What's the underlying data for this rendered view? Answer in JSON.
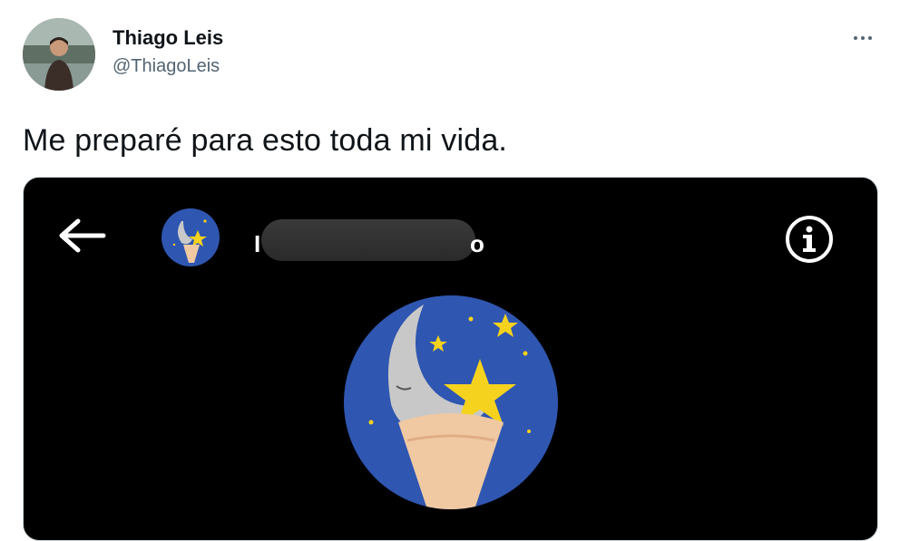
{
  "tweet": {
    "author_name": "Thiago Leis",
    "author_handle": "@ThiagoLeis",
    "text": "Me preparé para esto toda mi vida."
  },
  "screenshot": {
    "chat_name_prefix": "I",
    "chat_name_suffix": "o",
    "icons": [
      "back-arrow-icon",
      "info-icon",
      "more-icon"
    ]
  },
  "colors": {
    "text_primary": "#0f1419",
    "text_secondary": "#536471",
    "media_bg": "#000000",
    "avatar_blue": "#2f56b0",
    "star_yellow": "#f5d21e"
  }
}
